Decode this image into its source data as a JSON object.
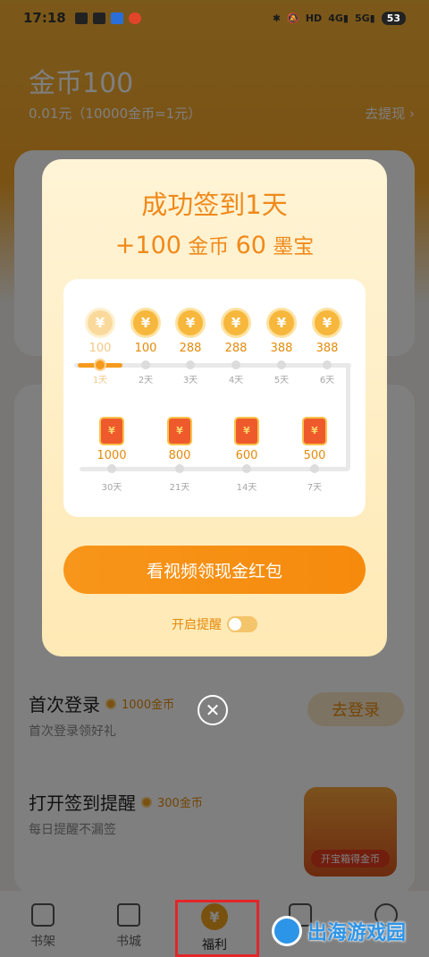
{
  "status_bar": {
    "time": "17:18",
    "left_icons": [
      "messages-icon",
      "mail-icon",
      "app-icon",
      "weibo-icon"
    ],
    "right_icons": [
      "bluetooth-icon",
      "mute-icon",
      "hd-icon",
      "signal-4g-icon",
      "signal-5g-icon"
    ],
    "battery": "53"
  },
  "header": {
    "coins_title": "金币100",
    "rate_text": "0.01元（10000金币=1元）",
    "withdraw_link": "去提现"
  },
  "background_tasks": [
    {
      "title": "首次登录",
      "reward": "1000金币",
      "desc": "首次登录领好礼",
      "button": "去登录"
    },
    {
      "title": "打开签到提醒",
      "reward": "300金币",
      "desc": "每日提醒不漏签"
    }
  ],
  "chest_label": "开宝箱得金币",
  "modal": {
    "title": "成功签到1天",
    "subtitle_prefix": "+100",
    "subtitle_coin_word": "金币",
    "subtitle_amount": "60",
    "subtitle_treasure_word": "墨宝",
    "top_row": [
      {
        "amount": "100",
        "day": "1天",
        "done": true
      },
      {
        "amount": "100",
        "day": "2天",
        "done": false
      },
      {
        "amount": "288",
        "day": "3天",
        "done": false
      },
      {
        "amount": "288",
        "day": "4天",
        "done": false
      },
      {
        "amount": "388",
        "day": "5天",
        "done": false
      },
      {
        "amount": "388",
        "day": "6天",
        "done": false
      }
    ],
    "bottom_row": [
      {
        "amount": "1000",
        "day": "30天"
      },
      {
        "amount": "800",
        "day": "21天"
      },
      {
        "amount": "600",
        "day": "14天"
      },
      {
        "amount": "500",
        "day": "7天"
      }
    ],
    "cta_button": "看视频领现金红包",
    "reminder_label": "开启提醒",
    "reminder_on": false
  },
  "tab_bar": {
    "tabs": [
      {
        "label": "书架",
        "icon": "bookshelf-icon"
      },
      {
        "label": "书城",
        "icon": "bookstore-icon"
      },
      {
        "label": "福利",
        "icon": "money-bag-icon"
      },
      {
        "label": "",
        "icon": "category-icon"
      },
      {
        "label": "",
        "icon": "profile-icon"
      }
    ],
    "active_tab": "福利",
    "active_tab_highlight_color": "#e3262a"
  },
  "watermark": "出海游戏园",
  "colors": {
    "accent": "#f59a1c",
    "brand_orange": "#f0891a",
    "modal_bg": "#fff4d6"
  }
}
